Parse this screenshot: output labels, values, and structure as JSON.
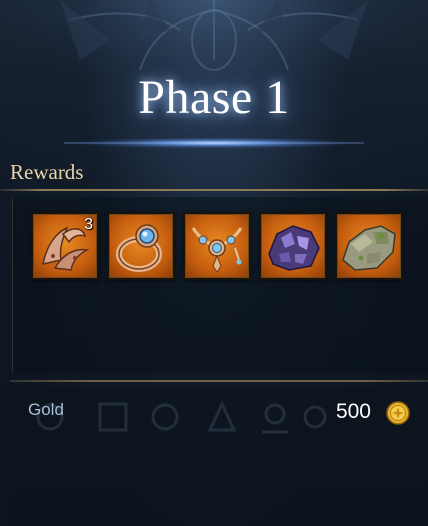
{
  "phase": {
    "title": "Phase 1"
  },
  "rewards": {
    "header": "Rewards",
    "items": [
      {
        "icon": "tentacle-material-icon",
        "quantity": "3"
      },
      {
        "icon": "sapphire-ring-icon"
      },
      {
        "icon": "jeweled-necklace-icon"
      },
      {
        "icon": "amethyst-ore-icon"
      },
      {
        "icon": "mossy-stone-icon"
      }
    ],
    "slot_color": "#d8731a"
  },
  "gold": {
    "label": "Gold",
    "value": "500",
    "icon": "gold-coin-icon"
  },
  "colors": {
    "header_text": "#e8d5a8",
    "gold_label": "#a9bcd6",
    "rule": "#8c7a55"
  }
}
